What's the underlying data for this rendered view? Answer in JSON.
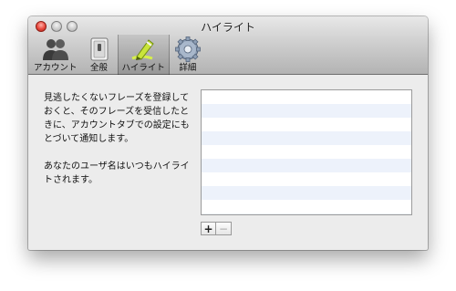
{
  "window": {
    "title": "ハイライト"
  },
  "toolbar": {
    "tabs": [
      {
        "label": "アカウント",
        "icon": "accounts-icon"
      },
      {
        "label": "全般",
        "icon": "general-switch-icon"
      },
      {
        "label": "ハイライト",
        "icon": "highlighter-icon",
        "selected": true
      },
      {
        "label": "詳細",
        "icon": "gear-icon"
      }
    ]
  },
  "description": {
    "paragraph1": "見逃したくないフレーズを登録しておくと、そのフレーズを受信したときに、アカウントタブでの設定にもとづいて通知します。",
    "paragraph2": "あなたのユーザ名はいつもハイライトされます。"
  },
  "phrases": {
    "items": []
  },
  "buttons": {
    "add_label": "+",
    "remove_label": "−"
  },
  "colors": {
    "row_alt": "#edf2fb",
    "close_button": "#e8473c"
  }
}
